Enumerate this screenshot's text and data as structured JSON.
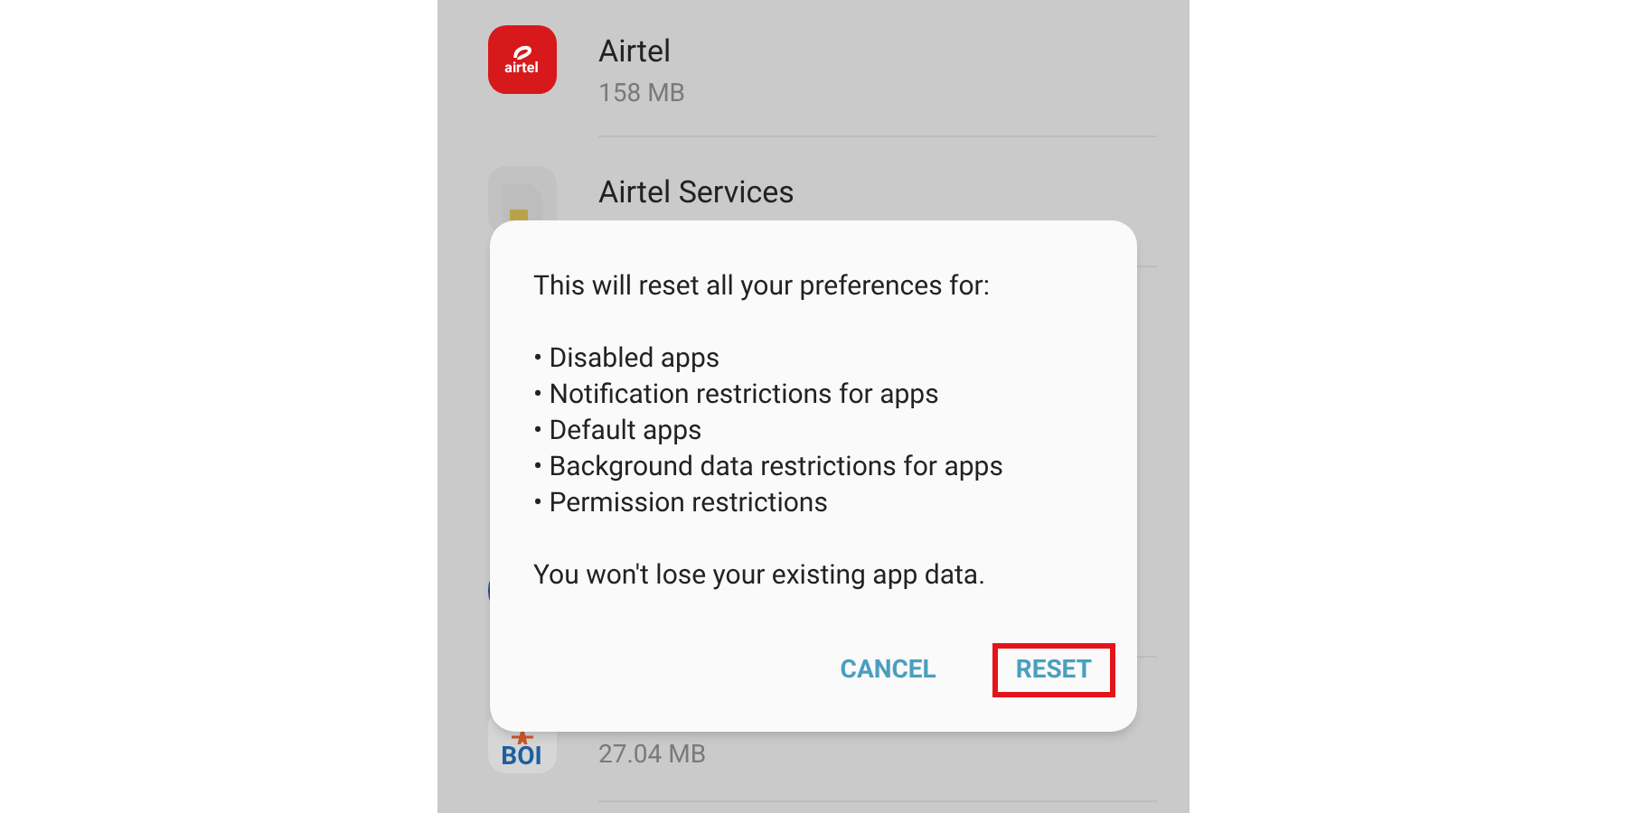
{
  "apps": [
    {
      "kind": "logo",
      "icon_label": "airtel",
      "name": "Airtel",
      "size": "158 MB"
    },
    {
      "kind": "sim",
      "name": "Airtel Services"
    },
    {
      "kind": "round"
    },
    {
      "kind": "emblem",
      "icon_label": "BOI",
      "size": "27.04 MB"
    }
  ],
  "dialog": {
    "intro": "This will reset all your preferences for:",
    "items": [
      "• Disabled apps",
      "• Notification restrictions for apps",
      "• Default apps",
      "• Background data restrictions for apps",
      "• Permission restrictions"
    ],
    "note": "You won't lose your existing app data.",
    "buttons": [
      {
        "label": "CANCEL",
        "highlighted": false
      },
      {
        "label": "RESET",
        "highlighted": true
      }
    ]
  }
}
